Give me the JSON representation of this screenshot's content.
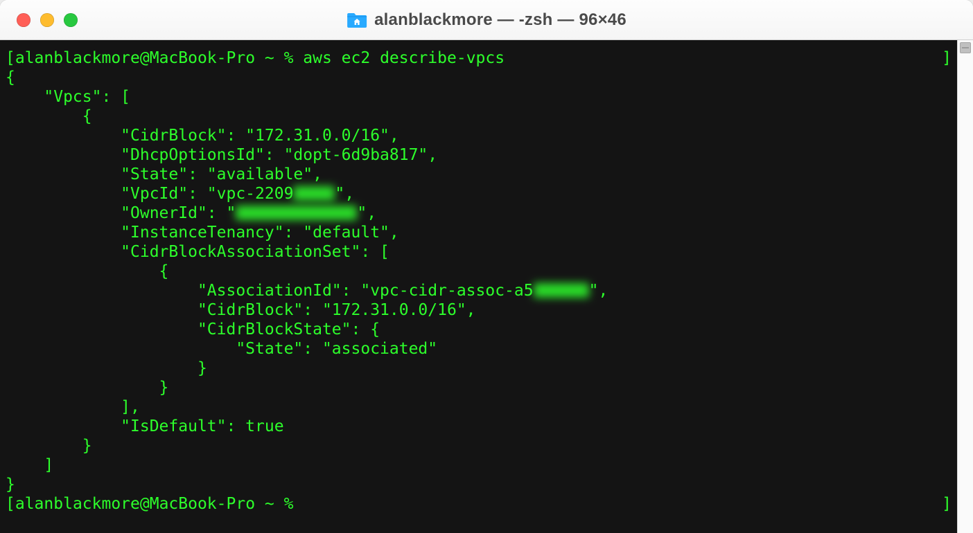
{
  "window": {
    "title": "alanblackmore — -zsh — 96×46"
  },
  "prompt": {
    "open": "[",
    "close": "]",
    "user_host": "alanblackmore@MacBook-Pro",
    "separator": " ~ % ",
    "command": "aws ec2 describe-vpcs"
  },
  "output": {
    "l0": "{",
    "l1": "    \"Vpcs\": [",
    "l2": "        {",
    "l3": "            \"CidrBlock\": \"172.31.0.0/16\",",
    "l4": "            \"DhcpOptionsId\": \"dopt-6d9ba817\",",
    "l5": "            \"State\": \"available\",",
    "l6a": "            \"VpcId\": \"vpc-2209",
    "l6b": "\",",
    "l7a": "            \"OwnerId\": \"",
    "l7b": "\",",
    "l8": "            \"InstanceTenancy\": \"default\",",
    "l9": "            \"CidrBlockAssociationSet\": [",
    "l10": "                {",
    "l11a": "                    \"AssociationId\": \"vpc-cidr-assoc-a5",
    "l11b": "\",",
    "l12": "                    \"CidrBlock\": \"172.31.0.0/16\",",
    "l13": "                    \"CidrBlockState\": {",
    "l14": "                        \"State\": \"associated\"",
    "l15": "                    }",
    "l16": "                }",
    "l17": "            ],",
    "l18": "            \"IsDefault\": true",
    "l19": "        }",
    "l20": "    ]",
    "l21": "}"
  },
  "redacted_widths": {
    "vpc": 60,
    "owner": 175,
    "assoc": 80
  }
}
